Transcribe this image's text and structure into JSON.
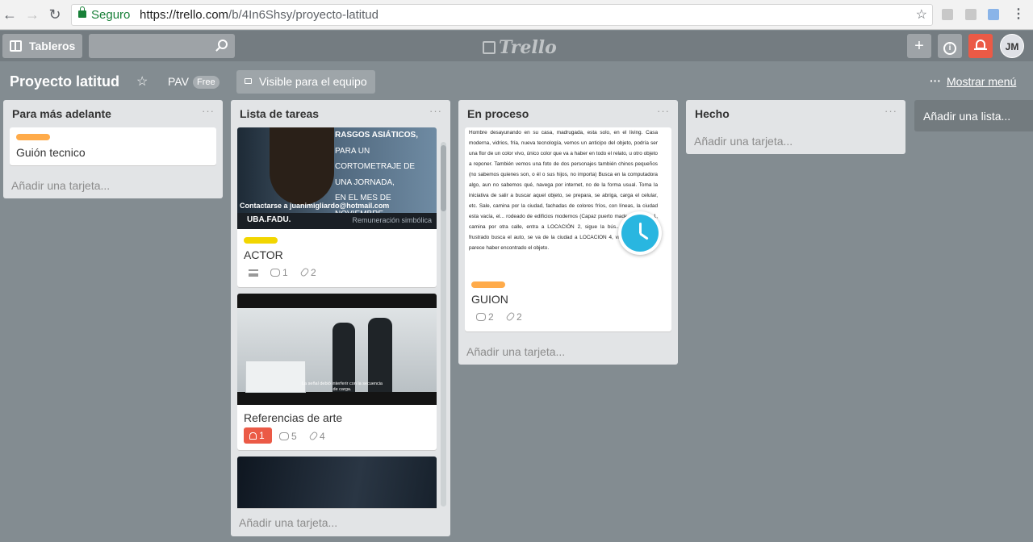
{
  "browser": {
    "secure_label": "Seguro",
    "url_host": "https://trello.com",
    "url_path": "/b/4In6Shsy/proyecto-latitud"
  },
  "header": {
    "boards_label": "Tableros",
    "logo": "Trello",
    "avatar_initials": "JM"
  },
  "board": {
    "title": "Proyecto latitud",
    "team": "PAV",
    "team_badge": "Free",
    "visibility": "Visible para el equipo",
    "menu_label": "Mostrar menú"
  },
  "lists": [
    {
      "title": "Para más adelante",
      "add_card": "Añadir una tarjeta...",
      "cards": [
        {
          "title": "Guión tecnico",
          "label_color": "#ffab4a"
        }
      ]
    },
    {
      "title": "Lista de tareas",
      "add_card": "Añadir una tarjeta...",
      "cards": [
        {
          "title": "ACTOR",
          "label_color": "#f2d600",
          "comments": "1",
          "attachments": "2",
          "cover_lines": [
            "RASGOS ASIÁTICOS,",
            "PARA UN",
            "CORTOMETRAJE DE",
            "UNA JORNADA,",
            "EN EL MES DE NOVIEMBRE"
          ],
          "cover_contact": "Contactarse a juanimigliardo@hotmail.com",
          "cover_org": "UBA.FADU.",
          "cover_remu": "Remuneración simbólica"
        },
        {
          "title": "Referencias de arte",
          "due": "1",
          "comments": "5",
          "attachments": "4",
          "cover_subtitle": "La señal debió interferir con la secuencia de carga."
        },
        {
          "title": ""
        }
      ]
    },
    {
      "title": "En proceso",
      "add_card": "Añadir una tarjeta...",
      "cards": [
        {
          "title": "GUION",
          "label_color": "#ffab4a",
          "comments": "2",
          "attachments": "2",
          "cover_text": "Hombre desayunando en su casa, madrugada, esta solo, en el living. Casa moderna, vidrios, fría, nueva tecnología, vemos un anticipo del objeto, podría ser una flor de un color vivo, único color que va a haber en todo el relato, u otro objeto a reponer. También vemos una foto de dos personajes también chinos pequeños (no sabemos quienes son, o él o sus hijos, no importa) Busca en la computadora algo, aun no sabemos qué, navega por internet, no de la forma usual. Toma la iniciativa de salir a buscar aquel objeto, se prepara, se abriga, carga el celular, etc. Sale, camina por la ciudad, fachadas de colores fríos, con líneas, la ciudad esta vacía, el... rodeado de edificios modernos (Capaz puerto madero) entra... 1, camina por otra calle, entra a LOCACIÓN 2, sigue la bús... LOCACION 3, frustrado busca el auto, se va de la ciudad a LOCACION 4, vuelve a su casa, parece haber encontrado el objeto."
        }
      ]
    },
    {
      "title": "Hecho",
      "add_card": "Añadir una tarjeta...",
      "cards": []
    }
  ],
  "add_list": "Añadir una lista..."
}
